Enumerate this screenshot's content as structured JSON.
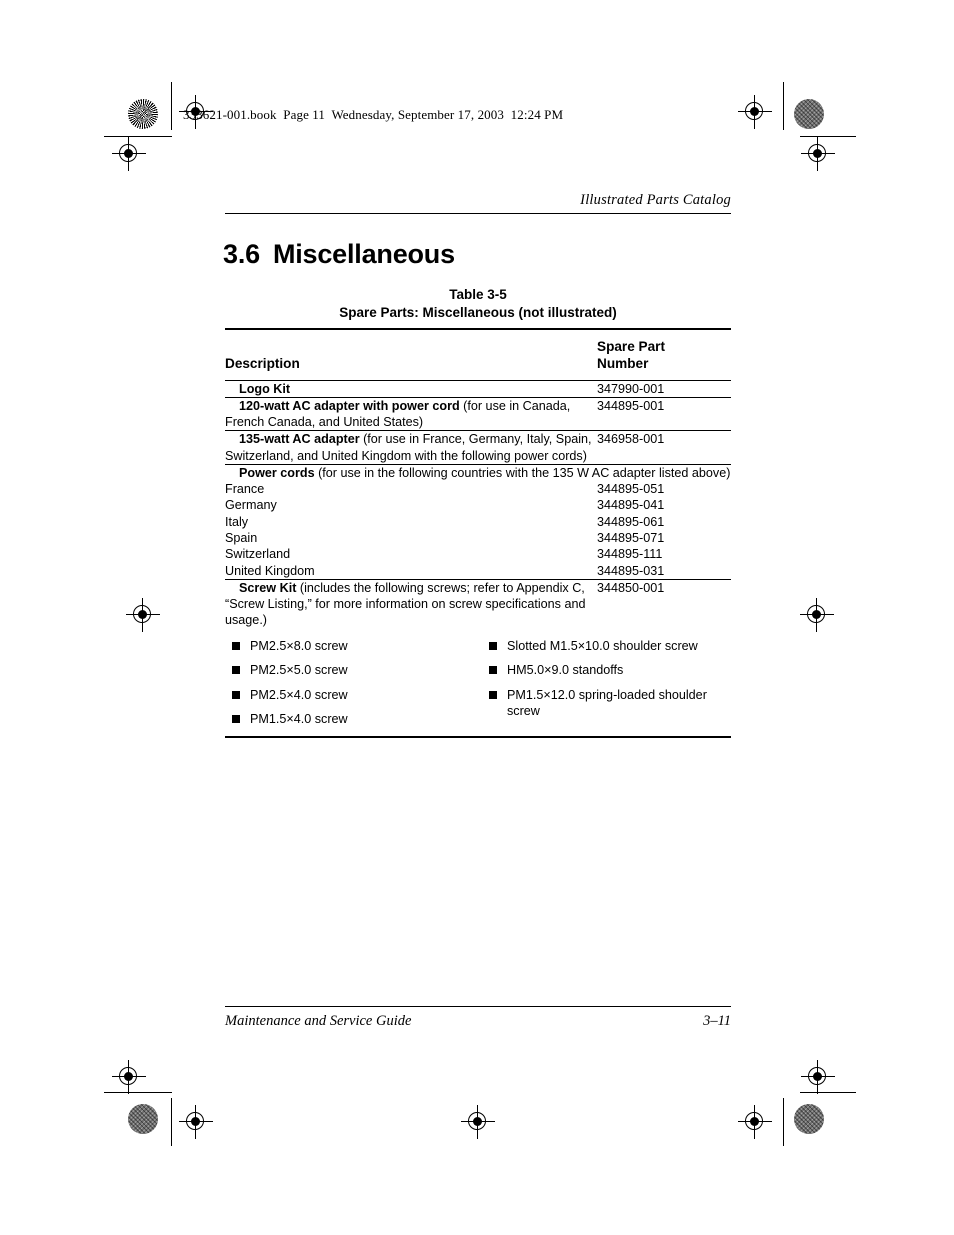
{
  "book_banner": "333621-001.book  Page 11  Wednesday, September 17, 2003  12:24 PM",
  "running_head": "Illustrated Parts Catalog",
  "section": {
    "number": "3.6",
    "title": "Miscellaneous"
  },
  "table_caption": {
    "line1": "Table 3-5",
    "line2": "Spare Parts: Miscellaneous (not illustrated)"
  },
  "table": {
    "headers": {
      "description": "Description",
      "spare_part_number_line1": "Spare Part",
      "spare_part_number_line2": "Number"
    },
    "rows": [
      {
        "bold": "Logo Kit",
        "rest": "",
        "number": "347990-001"
      },
      {
        "bold": "120-watt AC adapter with power cord",
        "rest": " (for use in Canada, French Canada, and United States)",
        "number": "344895-001"
      },
      {
        "bold": "135-watt AC adapter",
        "rest": " (for use in France, Germany, Italy, Spain, Switzerland, and United Kingdom with the following power cords)",
        "number": "346958-001"
      }
    ],
    "power_cords": {
      "bold": "Power cords",
      "rest": " (for use in the following countries with the 135 W AC adapter listed above)",
      "items": [
        {
          "country": "France",
          "number": "344895-051"
        },
        {
          "country": "Germany",
          "number": "344895-041"
        },
        {
          "country": "Italy",
          "number": "344895-061"
        },
        {
          "country": "Spain",
          "number": "344895-071"
        },
        {
          "country": "Switzerland",
          "number": "344895-111"
        },
        {
          "country": "United Kingdom",
          "number": "344895-031"
        }
      ]
    },
    "screw_kit": {
      "bold": "Screw Kit",
      "rest": " (includes the following screws; refer to Appendix C, “Screw Listing,” for more information on screw specifications and usage.)",
      "number": "344850-001",
      "left_column": [
        "PM2.5×8.0 screw",
        "PM2.5×5.0 screw",
        "PM2.5×4.0 screw",
        "PM1.5×4.0 screw"
      ],
      "right_column": [
        "Slotted M1.5×10.0 shoulder screw",
        "HM5.0×9.0 standoffs",
        "PM1.5×12.0 spring-loaded shoulder screw"
      ]
    }
  },
  "footer": {
    "guide_title": "Maintenance and Service Guide",
    "page_number": "3–11"
  }
}
